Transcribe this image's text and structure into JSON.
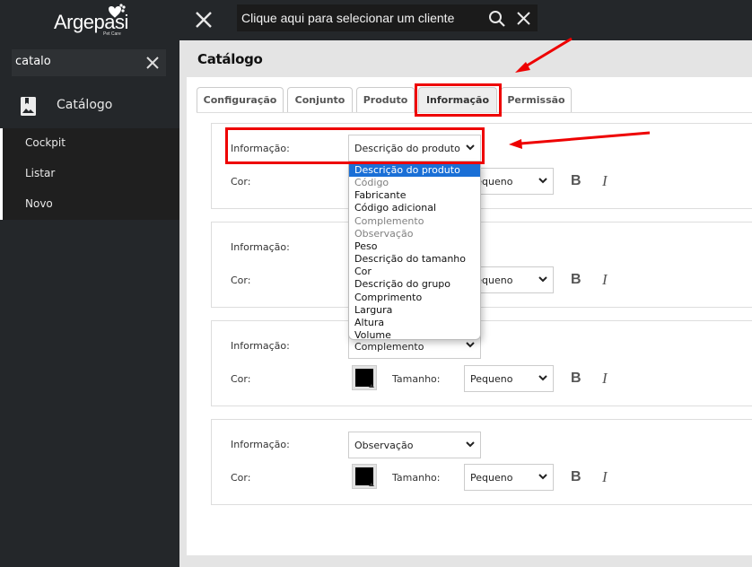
{
  "brand": {
    "name": "Argepasi",
    "tagline": "Pet Care"
  },
  "sidebar": {
    "search_value": "catalo",
    "menu_item": "Catálogo",
    "submenu": [
      "Cockpit",
      "Listar",
      "Novo"
    ]
  },
  "topbar": {
    "client_search_placeholder": "Clique aqui para selecionar um cliente"
  },
  "page": {
    "title": "Catálogo",
    "tabs": [
      {
        "label": "Configuração",
        "active": false
      },
      {
        "label": "Conjunto",
        "active": false
      },
      {
        "label": "Produto",
        "active": false
      },
      {
        "label": "Informação",
        "active": true
      },
      {
        "label": "Permissão",
        "active": false
      }
    ]
  },
  "labels": {
    "informacao": "Informação:",
    "cor": "Cor:",
    "tamanho": "Tamanho:",
    "bold": "B",
    "italic": "I"
  },
  "sections": [
    {
      "informacao": "Descrição do produto",
      "cor": "#000000",
      "tamanho": "Pequeno"
    },
    {
      "informacao": "",
      "cor": "#000000",
      "tamanho": "Pequeno"
    },
    {
      "informacao": "Complemento",
      "cor": "#000000",
      "tamanho": "Pequeno"
    },
    {
      "informacao": "Observação",
      "cor": "#000000",
      "tamanho": "Pequeno"
    }
  ],
  "dropdown": {
    "options": [
      {
        "label": "Descrição do produto",
        "state": "selected"
      },
      {
        "label": "Código",
        "state": "disabled"
      },
      {
        "label": "Fabricante",
        "state": "enabled"
      },
      {
        "label": "Código adicional",
        "state": "enabled"
      },
      {
        "label": "Complemento",
        "state": "disabled"
      },
      {
        "label": "Observação",
        "state": "disabled"
      },
      {
        "label": "Peso",
        "state": "enabled"
      },
      {
        "label": "Descrição do tamanho",
        "state": "enabled"
      },
      {
        "label": "Cor",
        "state": "enabled"
      },
      {
        "label": "Descrição do grupo",
        "state": "enabled"
      },
      {
        "label": "Comprimento",
        "state": "enabled"
      },
      {
        "label": "Largura",
        "state": "enabled"
      },
      {
        "label": "Altura",
        "state": "enabled"
      },
      {
        "label": "Volume",
        "state": "enabled"
      }
    ]
  },
  "colors": {
    "sidebar_bg": "#24272a",
    "selected_option": "#1a6fd6",
    "annotation_red": "#ee0000"
  }
}
